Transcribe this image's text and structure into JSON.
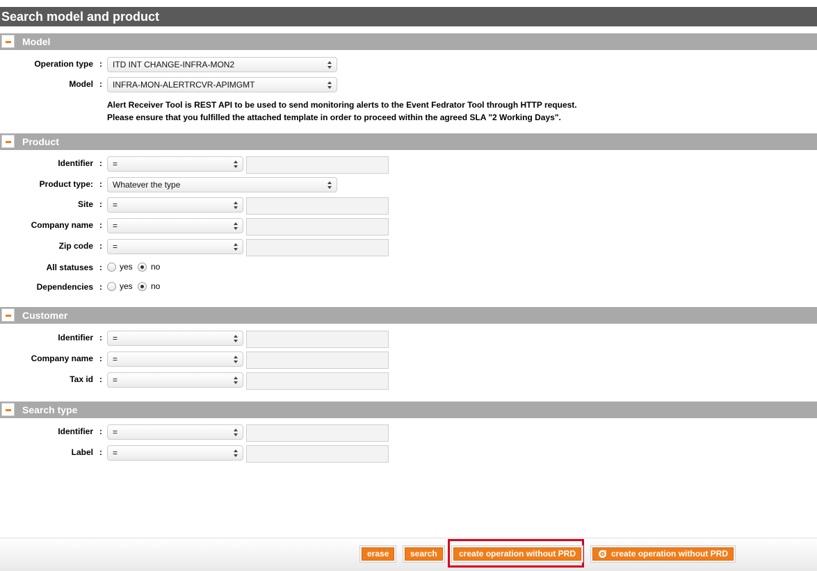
{
  "page": {
    "title": "Search model and product"
  },
  "sections": {
    "model": {
      "title": "Model",
      "operation_type": {
        "label": "Operation type",
        "value": "ITD INT CHANGE-INFRA-MON2"
      },
      "model": {
        "label": "Model",
        "value": "INFRA-MON-ALERTRCVR-APIMGMT"
      },
      "description_lines": [
        "Alert Receiver Tool is REST API to be used to send monitoring alerts to the Event Fedrator Tool through HTTP request.",
        "Please ensure that you fulfilled the attached template in order to proceed within the agreed SLA \"2 Working Days\"."
      ]
    },
    "product": {
      "title": "Product",
      "identifier": {
        "label": "Identifier",
        "operator": "=",
        "value": ""
      },
      "product_type": {
        "label": "Product type:",
        "value": "Whatever the type"
      },
      "site": {
        "label": "Site",
        "operator": "=",
        "value": ""
      },
      "company_name": {
        "label": "Company name",
        "operator": "=",
        "value": ""
      },
      "zip_code": {
        "label": "Zip code",
        "operator": "=",
        "value": ""
      },
      "all_statuses": {
        "label": "All statuses",
        "yes": "yes",
        "no": "no",
        "selected": "no"
      },
      "dependencies": {
        "label": "Dependencies",
        "yes": "yes",
        "no": "no",
        "selected": "no"
      }
    },
    "customer": {
      "title": "Customer",
      "identifier": {
        "label": "Identifier",
        "operator": "=",
        "value": ""
      },
      "company_name": {
        "label": "Company name",
        "operator": "=",
        "value": ""
      },
      "tax_id": {
        "label": "Tax id",
        "operator": "=",
        "value": ""
      }
    },
    "search_type": {
      "title": "Search type",
      "identifier": {
        "label": "Identifier",
        "operator": "=",
        "value": ""
      },
      "label": {
        "label": "Label",
        "operator": "=",
        "value": ""
      }
    }
  },
  "colon": ":",
  "footer": {
    "erase": "erase",
    "search": "search",
    "create_highlighted": "create operation without PRD",
    "create_with_icon": "create operation without PRD"
  },
  "colors": {
    "header_bg": "#5a5a5a",
    "section_bg": "#a9a9a9",
    "accent_orange": "#f07d1a",
    "highlight_red": "#d9001b"
  },
  "icons": {
    "collapse": "minus-icon",
    "dress_button": "gear-icon"
  }
}
